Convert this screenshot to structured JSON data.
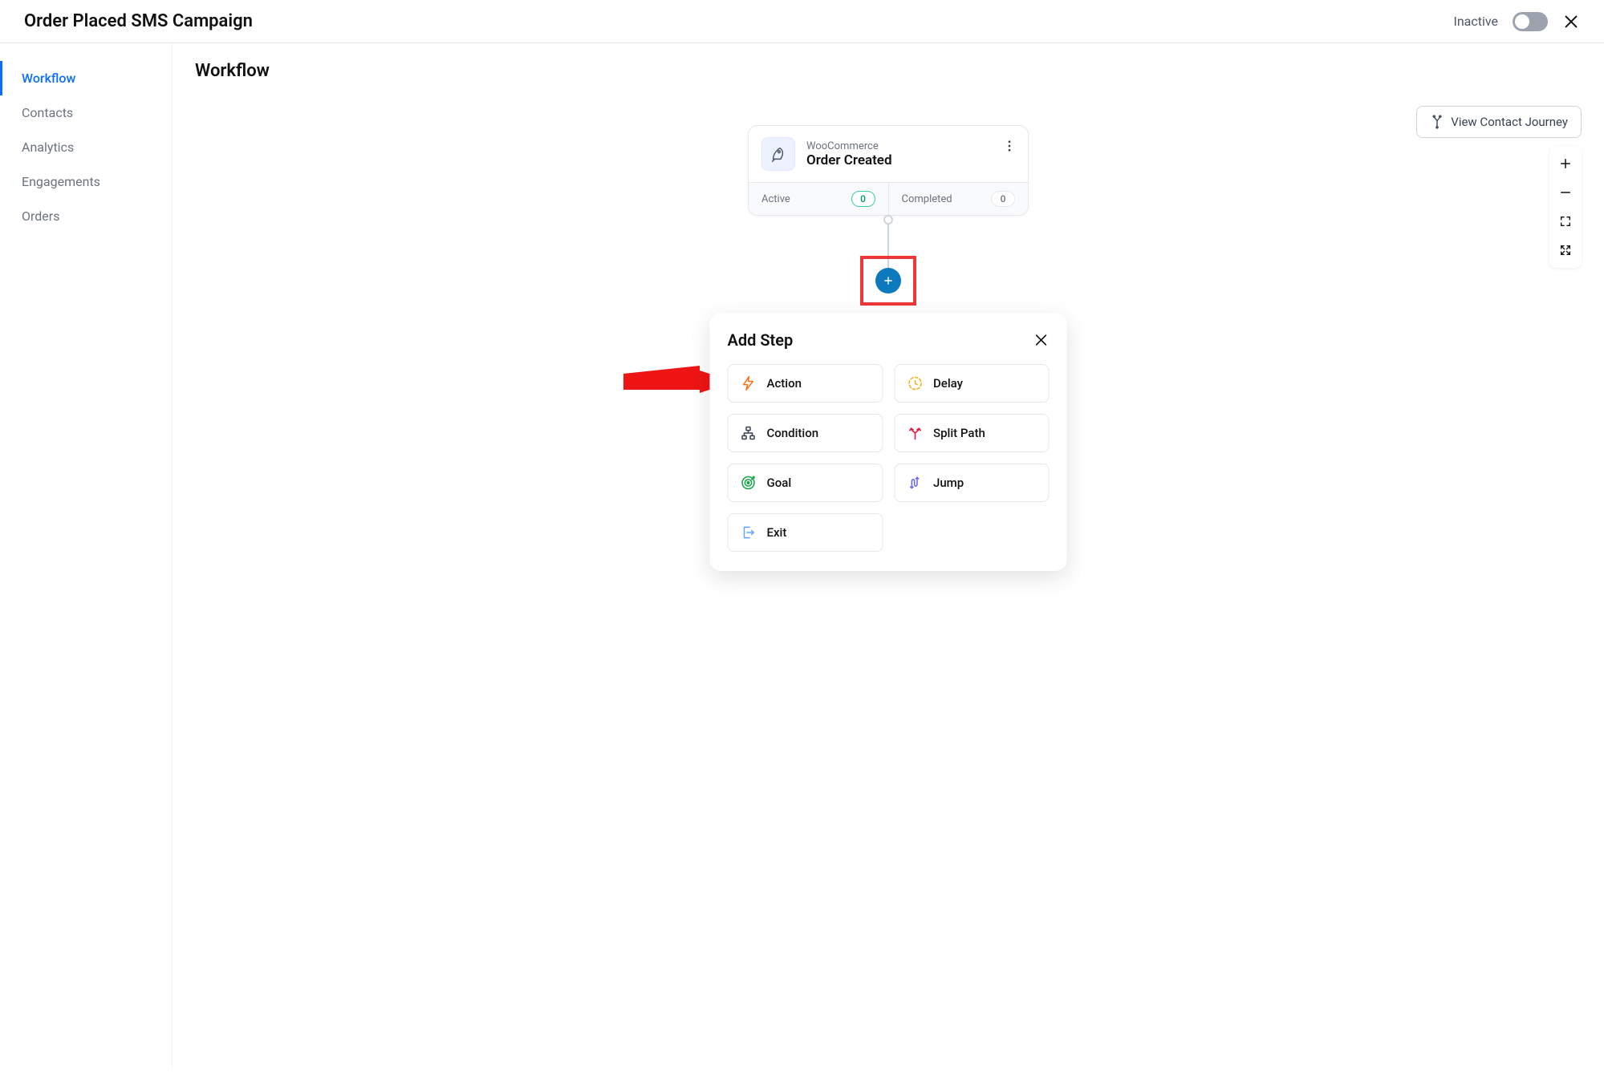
{
  "header": {
    "title": "Order Placed SMS Campaign",
    "status_label": "Inactive"
  },
  "sidebar": {
    "items": [
      {
        "label": "Workflow",
        "active": true
      },
      {
        "label": "Contacts",
        "active": false
      },
      {
        "label": "Analytics",
        "active": false
      },
      {
        "label": "Engagements",
        "active": false
      },
      {
        "label": "Orders",
        "active": false
      }
    ]
  },
  "section_title": "Workflow",
  "journey_button": "View Contact Journey",
  "trigger": {
    "source": "WooCommerce",
    "title": "Order Created",
    "stats": {
      "active_label": "Active",
      "active_count": "0",
      "completed_label": "Completed",
      "completed_count": "0"
    }
  },
  "modal": {
    "title": "Add Step",
    "steps": [
      {
        "label": "Action",
        "icon": "bolt",
        "color": "#f97316"
      },
      {
        "label": "Delay",
        "icon": "clock",
        "color": "#eab308"
      },
      {
        "label": "Condition",
        "icon": "sitemap",
        "color": "#374151"
      },
      {
        "label": "Split Path",
        "icon": "split",
        "color": "#e11d48"
      },
      {
        "label": "Goal",
        "icon": "target",
        "color": "#16a34a"
      },
      {
        "label": "Jump",
        "icon": "jump",
        "color": "#6366f1"
      },
      {
        "label": "Exit",
        "icon": "exit",
        "color": "#60a5fa"
      }
    ]
  }
}
